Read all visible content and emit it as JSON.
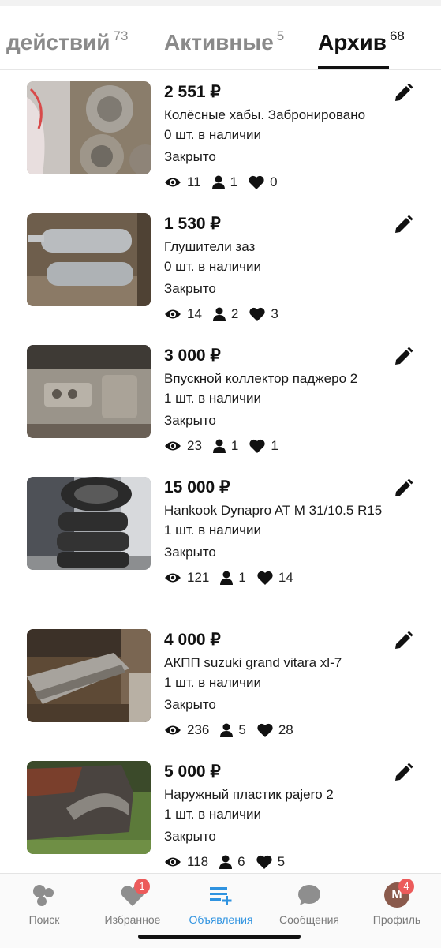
{
  "tabs": [
    {
      "label": "действий",
      "count": "73"
    },
    {
      "label": "Активные",
      "count": "5"
    },
    {
      "label": "Архив",
      "count": "68"
    }
  ],
  "listings": [
    {
      "price": "2 551 ₽",
      "title": "Колёсные хабы. Забронировано",
      "stock": "0 шт. в наличии",
      "status": "Закрыто",
      "views": "11",
      "contacts": "1",
      "likes": "0"
    },
    {
      "price": "1 530 ₽",
      "title": "Глушители заз",
      "stock": "0 шт. в наличии",
      "status": "Закрыто",
      "views": "14",
      "contacts": "2",
      "likes": "3"
    },
    {
      "price": "3 000 ₽",
      "title": "Впускной коллектор паджеро 2",
      "stock": "1 шт. в наличии",
      "status": "Закрыто",
      "views": "23",
      "contacts": "1",
      "likes": "1"
    },
    {
      "price": "15 000 ₽",
      "title": "Hankook Dynapro AT M 31/10.5 R15",
      "stock": "1 шт. в наличии",
      "status": "Закрыто",
      "views": "121",
      "contacts": "1",
      "likes": "14"
    },
    {
      "price": "4 000 ₽",
      "title": "АКПП suzuki grand vitara xl-7",
      "stock": "1 шт. в наличии",
      "status": "Закрыто",
      "views": "236",
      "contacts": "5",
      "likes": "28"
    },
    {
      "price": "5 000 ₽",
      "title": "Наружный пластик pajero 2",
      "stock": "1 шт. в наличии",
      "status": "Закрыто",
      "views": "118",
      "contacts": "6",
      "likes": "5"
    }
  ],
  "nav": {
    "search": "Поиск",
    "favorites": "Избранное",
    "favorites_badge": "1",
    "listings": "Объявления",
    "messages": "Сообщения",
    "profile": "Профиль",
    "profile_badge": "4",
    "profile_initials": "М"
  },
  "colors": {
    "accent": "#2f93e0",
    "badge": "#ec5b5b"
  }
}
